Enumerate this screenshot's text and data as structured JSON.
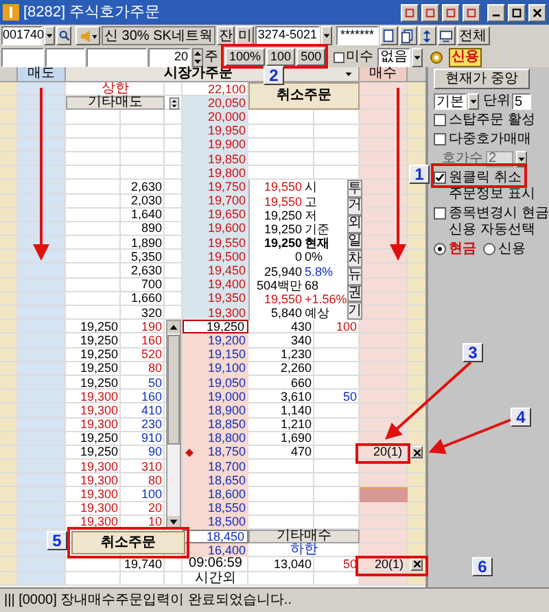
{
  "window": {
    "title": "[8282] 주식호가주문"
  },
  "toolbar": {
    "stock_code": "001740",
    "stock_name": "신 30% SK네트웍",
    "balance_button": "잔",
    "unfilled_button": "미",
    "account": "3274-5021",
    "password": "*******",
    "all_button": "전체",
    "quantity": "20",
    "unit": "주",
    "quick_buttons": [
      "100%",
      "100",
      "500"
    ],
    "margin_checkbox": {
      "label": "미수",
      "checked": false
    },
    "margin_option": "없음",
    "credit_button": "신용"
  },
  "order_book": {
    "headers": {
      "sell": "매도",
      "market_order": "시장가주문",
      "buy": "매수"
    },
    "upper_limit": {
      "label": "상한",
      "price": "22,100"
    },
    "cancel_button": "취소주문",
    "other_sell": {
      "label": "기타매도",
      "price": "20,050"
    },
    "asks": [
      {
        "price": "20,000"
      },
      {
        "price": "19,950"
      },
      {
        "price": "19,900"
      },
      {
        "price": "19,850"
      },
      {
        "price": "19,800"
      },
      {
        "price": "19,750",
        "qty": "2,630"
      },
      {
        "price": "19,700",
        "qty": "2,030"
      },
      {
        "price": "19,650",
        "qty": "1,640"
      },
      {
        "price": "19,600",
        "qty": "890"
      },
      {
        "price": "19,550",
        "qty": "1,890"
      },
      {
        "price": "19,500",
        "qty": "5,350"
      },
      {
        "price": "19,450",
        "qty": "2,630"
      },
      {
        "price": "19,400",
        "qty": "700"
      },
      {
        "price": "19,350",
        "qty": "1,660"
      },
      {
        "price": "19,300",
        "qty": "320"
      }
    ],
    "market_info": [
      {
        "figure": "19,550",
        "rise": true,
        "tag": "시",
        "tag_rise": false,
        "tag_fall": false,
        "emphasis": false
      },
      {
        "figure": "19,550",
        "rise": true,
        "tag": "고",
        "tag_rise": false,
        "tag_fall": false,
        "emphasis": false
      },
      {
        "figure": "19,250",
        "rise": false,
        "tag": "저",
        "tag_rise": false,
        "tag_fall": false,
        "emphasis": false
      },
      {
        "figure": "19,250",
        "rise": false,
        "tag": "기준",
        "tag_rise": false,
        "tag_fall": false,
        "emphasis": false
      },
      {
        "figure": "19,250",
        "rise": false,
        "tag": "현재",
        "tag_rise": false,
        "tag_fall": false,
        "emphasis": true
      },
      {
        "figure": "0",
        "rise": false,
        "tag": "0%",
        "tag_rise": false,
        "tag_fall": false,
        "emphasis": false
      },
      {
        "figure": "25,940",
        "rise": false,
        "tag": "5.8%",
        "tag_rise": false,
        "tag_fall": true,
        "emphasis": false
      },
      {
        "figure": "504백만",
        "rise": false,
        "tag": "68",
        "tag_rise": false,
        "tag_fall": false,
        "emphasis": false
      },
      {
        "figure": "19,550",
        "rise": true,
        "tag": "+1.56%",
        "tag_rise": true,
        "tag_fall": false,
        "emphasis": false
      },
      {
        "figure": "5,840",
        "rise": false,
        "tag": "예상",
        "tag_rise": false,
        "tag_fall": false,
        "emphasis": false
      }
    ],
    "info_tabs": [
      "투",
      "거",
      "외",
      "일",
      "차",
      "뉴",
      "권",
      "기"
    ],
    "bids": [
      {
        "price": "19,250",
        "current": true,
        "trade_price": "19,250",
        "trade_rise": false,
        "trade_qty": "190",
        "trade_qty_rise": true,
        "qty": "430",
        "extra": "100",
        "extra_rise": true
      },
      {
        "price": "19,200",
        "current": false,
        "trade_price": "19,250",
        "trade_rise": false,
        "trade_qty": "160",
        "trade_qty_rise": true,
        "qty": "340"
      },
      {
        "price": "19,150",
        "current": false,
        "trade_price": "19,250",
        "trade_rise": false,
        "trade_qty": "520",
        "trade_qty_rise": true,
        "qty": "1,230"
      },
      {
        "price": "19,100",
        "current": false,
        "trade_price": "19,250",
        "trade_rise": false,
        "trade_qty": "80",
        "trade_qty_rise": true,
        "qty": "2,260"
      },
      {
        "price": "19,050",
        "current": false,
        "trade_price": "19,250",
        "trade_rise": false,
        "trade_qty": "50",
        "trade_qty_rise": false,
        "qty": "660"
      },
      {
        "price": "19,000",
        "current": false,
        "trade_price": "19,300",
        "trade_rise": true,
        "trade_qty": "160",
        "trade_qty_rise": false,
        "qty": "3,610",
        "extra": "50",
        "extra_rise": false
      },
      {
        "price": "18,900",
        "current": false,
        "trade_price": "19,300",
        "trade_rise": true,
        "trade_qty": "410",
        "trade_qty_rise": false,
        "qty": "1,140"
      },
      {
        "price": "18,850",
        "current": false,
        "trade_price": "19,300",
        "trade_rise": true,
        "trade_qty": "230",
        "trade_qty_rise": false,
        "qty": "1,210"
      },
      {
        "price": "18,800",
        "current": false,
        "trade_price": "19,250",
        "trade_rise": false,
        "trade_qty": "910",
        "trade_qty_rise": false,
        "qty": "1,690"
      },
      {
        "price": "18,750",
        "current": false,
        "pointer": true,
        "trade_price": "19,250",
        "trade_rise": false,
        "trade_qty": "90",
        "trade_qty_rise": false,
        "qty": "470",
        "order": "20(1)"
      },
      {
        "price": "18,700",
        "current": false,
        "trade_price": "19,300",
        "trade_rise": true,
        "trade_qty": "310",
        "trade_qty_rise": true
      },
      {
        "price": "18,650",
        "current": false,
        "trade_price": "19,300",
        "trade_rise": true,
        "trade_qty": "80",
        "trade_qty_rise": true
      },
      {
        "price": "18,600",
        "current": false,
        "highlight": true,
        "trade_price": "19,300",
        "trade_rise": true,
        "trade_qty": "100",
        "trade_qty_rise": false
      },
      {
        "price": "18,550",
        "current": false,
        "trade_price": "19,300",
        "trade_rise": true,
        "trade_qty": "20",
        "trade_qty_rise": true
      },
      {
        "price": "18,500",
        "current": false,
        "trade_price": "19,300",
        "trade_rise": true,
        "trade_qty": "10",
        "trade_qty_rise": true
      }
    ],
    "other_buy": {
      "label": "기타매수",
      "price": "18,450"
    },
    "lower_limit": {
      "label": "하한",
      "price": "16,400"
    },
    "summary": {
      "trade_price": "19,740",
      "time": "09:06:59",
      "qty": "13,040",
      "extra": "50",
      "order": "20(1)"
    },
    "session": "시간외",
    "floating_cancel_button": "취소주문"
  },
  "side_panel": {
    "center_button": "현재가 중앙",
    "mode": "기본",
    "unit_label": "단위",
    "unit": "5",
    "settings": [
      {
        "kind": "checkbox",
        "label": "스탑주문 활성",
        "checked": false
      },
      {
        "kind": "checkbox",
        "label": "다중호가매매",
        "checked": false
      },
      {
        "kind": "select",
        "label": "호가수",
        "value": "2",
        "disabled": true
      },
      {
        "kind": "checkbox",
        "label": "원클릭 취소",
        "checked": true,
        "note": "주문정보 표시"
      },
      {
        "kind": "checkbox",
        "label": "종목변경시 현금",
        "checked": false,
        "note": "신용 자동선택"
      }
    ],
    "payment": [
      {
        "label": "현금",
        "selected": true
      },
      {
        "label": "신용",
        "selected": false
      }
    ]
  },
  "annotations": [
    "1",
    "2",
    "3",
    "4",
    "5",
    "6"
  ],
  "status_bar": "||| [0000] 장내매수주문입력이 완료되었습니다.."
}
